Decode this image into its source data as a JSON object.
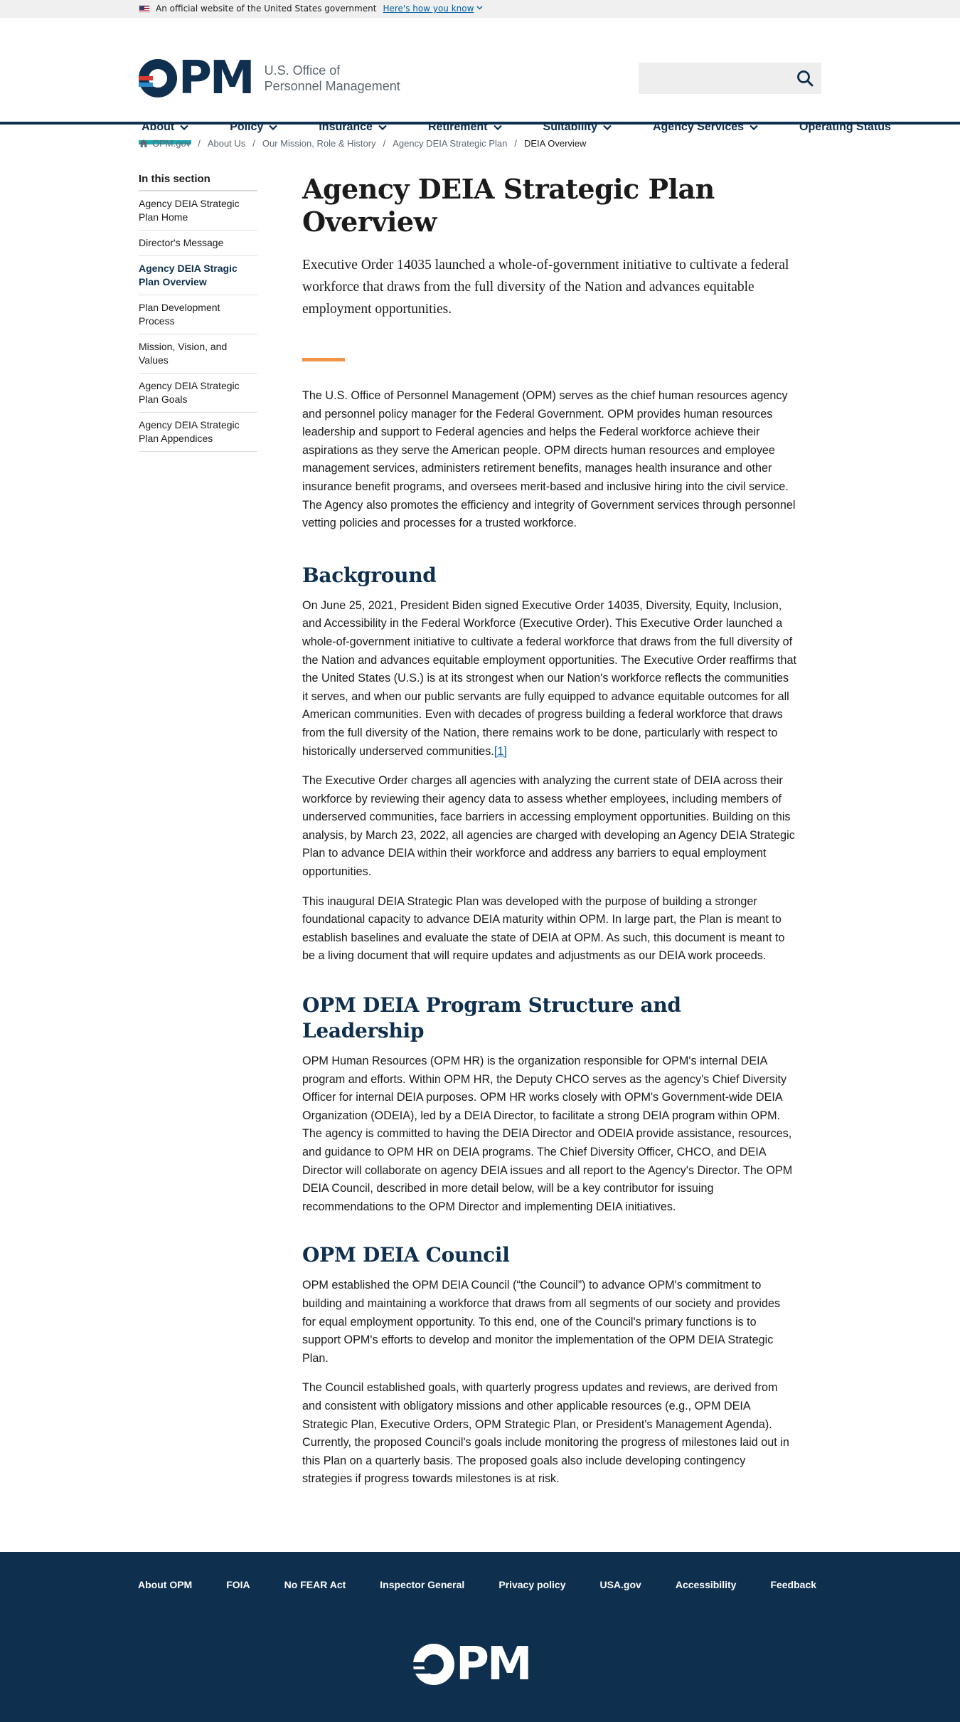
{
  "banner": {
    "text": "An official website of the United States government",
    "link": "Here's how you know"
  },
  "header": {
    "logo_mark": "PM",
    "logo_line1": "U.S. Office of",
    "logo_line2": "Personnel Management",
    "search_placeholder": ""
  },
  "nav": [
    {
      "label": "About",
      "active": true
    },
    {
      "label": "Policy"
    },
    {
      "label": "Insurance"
    },
    {
      "label": "Retirement"
    },
    {
      "label": "Suitability"
    },
    {
      "label": "Agency Services"
    },
    {
      "label": "Operating Status"
    }
  ],
  "breadcrumb": [
    "OPM.gov",
    "About Us",
    "Our Mission, Role & History",
    "Agency DEIA Strategic Plan",
    "DEIA Overview"
  ],
  "sidebar": {
    "title": "In this section",
    "items": [
      "Agency DEIA Strategic Plan Home",
      "Director's Message",
      "Agency DEIA Stragic Plan Overview",
      "Plan Development Process",
      "Mission, Vision, and Values",
      "Agency DEIA Strategic Plan Goals",
      "Agency DEIA Strategic Plan Appendices"
    ]
  },
  "main": {
    "title": "Agency DEIA Strategic Plan Overview",
    "lead": "Executive Order 14035 launched a whole-of-government initiative to cultivate a federal workforce that draws from the full diversity of the Nation and advances equitable employment opportunities.",
    "intro": "The U.S. Office of Personnel Management (OPM) serves as the chief human resources agency and personnel policy manager for the Federal Government. OPM provides human resources leadership and support to Federal agencies and helps the Federal workforce achieve their aspirations as they serve the American people. OPM directs human resources and employee management services, administers retirement benefits, manages health insurance and other insurance benefit programs, and oversees merit-based and inclusive hiring into the civil service. The Agency also promotes the efficiency and integrity of Government services through personnel vetting policies and processes for a trusted workforce.",
    "background_heading": "Background",
    "background_p1": "On June 25, 2021, President Biden signed Executive Order 14035, Diversity, Equity, Inclusion, and Accessibility in the Federal Workforce (Executive Order). This Executive Order launched a whole-of-government initiative to cultivate a federal workforce that draws from the full diversity of the Nation and advances equitable employment opportunities. The Executive Order reaffirms that the United States (U.S.) is at its strongest when our Nation's workforce reflects the communities it serves, and when our public servants are fully equipped to advance equitable outcomes for all American communities. Even with decades of progress building a federal workforce that draws from the full diversity of the Nation, there remains work to be done, particularly with respect to historically underserved communities.",
    "background_footnote": "[1]",
    "background_p2": "The Executive Order charges all agencies with analyzing the current state of DEIA across their workforce by reviewing their agency data to assess whether employees, including members of underserved communities, face barriers in accessing employment opportunities. Building on this analysis, by March 23, 2022, all agencies are charged with developing an Agency DEIA Strategic Plan to advance DEIA within their workforce and address any barriers to equal employment opportunities.",
    "background_p3": "This inaugural DEIA Strategic Plan was developed with the purpose of building a stronger foundational capacity to advance DEIA maturity within OPM. In large part, the Plan is meant to establish baselines and evaluate the state of DEIA at OPM. As such, this document is meant to be a living document that will require updates and adjustments as our DEIA work proceeds.",
    "structure_heading": "OPM DEIA Program Structure and Leadership",
    "structure_p1": "OPM Human Resources (OPM HR) is the organization responsible for OPM's internal DEIA program and efforts. Within OPM HR, the Deputy CHCO serves as the agency's Chief Diversity Officer for internal DEIA purposes. OPM HR works closely with OPM's Government-wide DEIA Organization (ODEIA), led by a DEIA Director, to facilitate a strong DEIA program within OPM. The agency is committed to having the DEIA Director and ODEIA provide assistance, resources, and guidance to OPM HR on DEIA programs. The Chief Diversity Officer, CHCO, and DEIA Director will collaborate on agency DEIA issues and all report to the Agency's Director. The OPM DEIA Council, described in more detail below, will be a key contributor for issuing recommendations to the OPM Director and implementing DEIA initiatives.",
    "council_heading": "OPM DEIA Council",
    "council_p1": "OPM established the OPM DEIA Council (“the Council”) to advance OPM's commitment to building and maintaining a workforce that draws from all segments of our society and provides for equal employment opportunity. To this end, one of the Council's primary functions is to support OPM's efforts to develop and monitor the implementation of the OPM DEIA Strategic Plan.",
    "council_p2": "The Council established goals, with quarterly progress updates and reviews, are derived from and consistent with obligatory missions and other applicable resources (e.g., OPM DEIA Strategic Plan, Executive Orders, OPM Strategic Plan, or President's Management Agenda). Currently, the proposed Council's goals include monitoring the progress of milestones laid out in this Plan on a quarterly basis. The proposed goals also include developing contingency strategies if progress towards milestones is at risk."
  },
  "footer": {
    "links": [
      "About OPM",
      "FOIA",
      "No FEAR Act",
      "Inspector General",
      "Privacy policy",
      "USA.gov",
      "Accessibility",
      "Feedback"
    ],
    "logo_mark": "PM"
  },
  "colors": {
    "navy": "#0e2f4e",
    "teal_active": "#1fa7b3",
    "orange_accent": "#f0944a",
    "link": "#005ea2"
  }
}
